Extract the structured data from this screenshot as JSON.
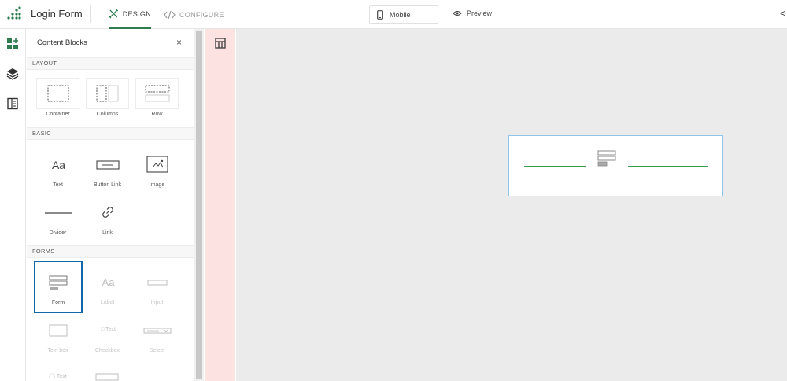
{
  "header": {
    "app_title": "Login Form",
    "tabs": [
      {
        "label": "DESIGN",
        "icon": "design-icon",
        "active": true
      },
      {
        "label": "CONFIGURE",
        "icon": "code-icon",
        "active": false
      }
    ],
    "device": {
      "label": "Mobile",
      "icon": "mobile-icon"
    },
    "preview_label": "Preview",
    "collapse_glyph": "<"
  },
  "rail": {
    "items": [
      {
        "icon": "add-block-icon",
        "active": true
      },
      {
        "icon": "layers-icon",
        "active": false
      },
      {
        "icon": "pages-icon",
        "active": false
      }
    ]
  },
  "panel": {
    "title": "Content Blocks",
    "close_glyph": "×",
    "sections": {
      "layout": {
        "title": "LAYOUT",
        "items": [
          {
            "label": "Container",
            "icon": "container-icon"
          },
          {
            "label": "Columns",
            "icon": "columns-icon"
          },
          {
            "label": "Row",
            "icon": "row-icon"
          }
        ]
      },
      "basic": {
        "title": "BASIC",
        "items": [
          {
            "label": "Text",
            "glyph": "Aa",
            "icon": "text-icon"
          },
          {
            "label": "Button Link",
            "icon": "button-link-icon"
          },
          {
            "label": "Image",
            "icon": "image-icon"
          },
          {
            "label": "Divider",
            "icon": "divider-icon"
          },
          {
            "label": "Link",
            "icon": "link-icon"
          }
        ]
      },
      "forms": {
        "title": "FORMS",
        "items": [
          {
            "label": "Form",
            "icon": "form-icon",
            "selected": true
          },
          {
            "label": "Label",
            "glyph": "Aa",
            "icon": "label-icon",
            "disabled": true
          },
          {
            "label": "Input",
            "icon": "input-icon",
            "disabled": true
          },
          {
            "label": "Text box",
            "icon": "textbox-icon",
            "disabled": true
          },
          {
            "label": "Checkbox",
            "glyph": "Text",
            "icon": "checkbox-icon",
            "disabled": true
          },
          {
            "label": "Select",
            "icon": "select-icon",
            "disabled": true
          },
          {
            "label": "",
            "glyph": "Text",
            "icon": "radio-icon",
            "disabled": true
          },
          {
            "label": "",
            "icon": "button-icon",
            "disabled": true
          }
        ]
      }
    }
  },
  "colors": {
    "accent_green": "#2e7d4f",
    "selected_border": "#1565a9",
    "strip_bg": "#fde2e2",
    "strip_border": "#e06b6b",
    "canvas_bg": "#ebebeb",
    "block_border": "#90c6ea",
    "form_line": "#3d9a4b"
  }
}
